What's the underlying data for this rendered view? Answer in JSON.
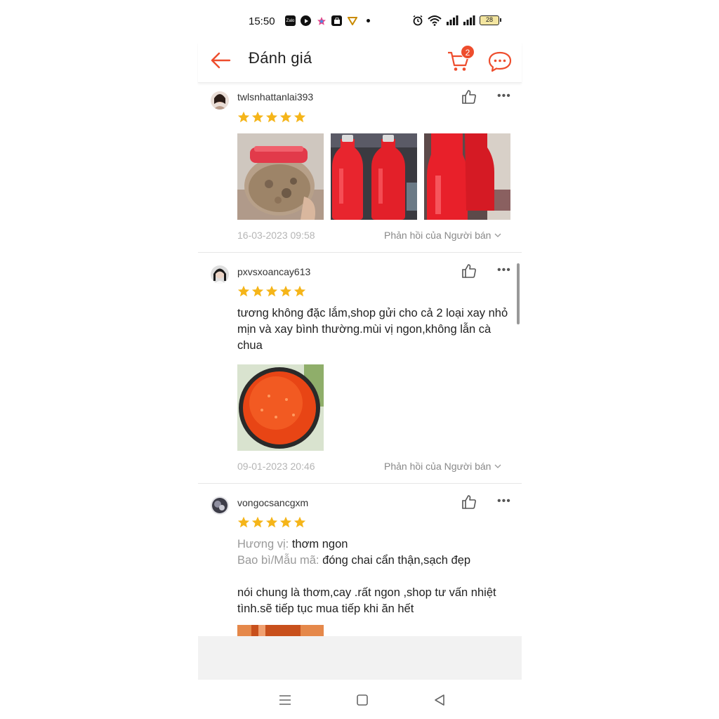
{
  "status_bar": {
    "time": "15:50",
    "battery": "28",
    "left_icons": [
      "zalo-icon",
      "play-icon",
      "star-app-icon",
      "shop-bag-icon",
      "v-app-icon",
      "dot-icon"
    ],
    "right_icons": [
      "alarm-icon",
      "wifi-icon",
      "signal-icon",
      "signal-icon",
      "battery-icon"
    ],
    "zalo_text": "Zalo"
  },
  "header": {
    "title": "Đánh giá",
    "cart_count": "2",
    "accent_color": "#ee4d2d"
  },
  "reviews": [
    {
      "username": "twlsnhattanlai393",
      "rating": 5,
      "photos": [
        "jar-photo",
        "bottles-photo",
        "bottles-photo"
      ],
      "date": "16-03-2023 09:58",
      "reply_label": "Phản hồi của Người bán"
    },
    {
      "username": "pxvsxoancay613",
      "rating": 5,
      "text": "tương không đặc lắm,shop gửi cho cả 2 loại xay nhỏ mịn và xay bình thường.mùi vị ngon,không lẫn cà chua",
      "photos": [
        "sauce-bowl-photo"
      ],
      "date": "09-01-2023 20:46",
      "reply_label": "Phản hồi của Người bán"
    },
    {
      "username": "vongocsancgxm",
      "rating": 5,
      "attributes": [
        {
          "label": "Hương vị:",
          "value": "thơm ngon"
        },
        {
          "label": "Bao bì/Mẫu mã:",
          "value": "đóng chai cẩn thận,sạch đẹp"
        }
      ],
      "text": "nói chung là thơm,cay .rất ngon ,shop tư vấn nhiệt tình.sẽ tiếp tục mua tiếp khi ăn hết",
      "photos": [
        "sauce-photo"
      ]
    }
  ],
  "colors": {
    "star": "#f5b519",
    "accent": "#ee4d2d",
    "muted_text": "#b5b5b5"
  }
}
